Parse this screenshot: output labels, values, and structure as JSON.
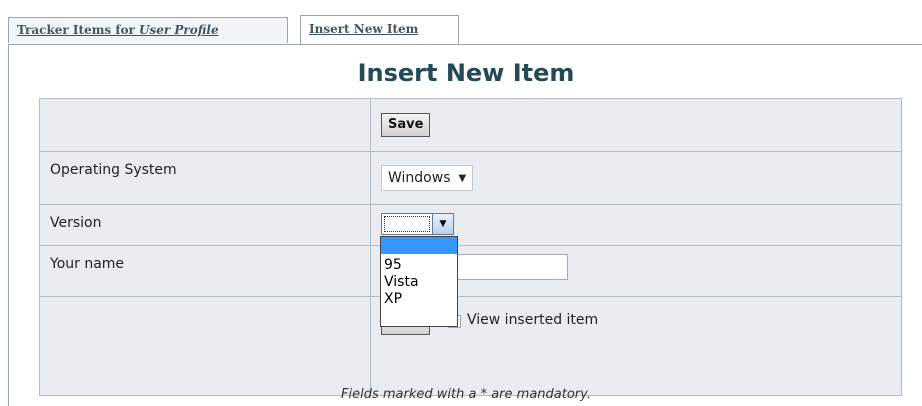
{
  "tabs": [
    {
      "label_prefix": "Tracker Items for ",
      "label_em": "User Profile"
    },
    {
      "label": "Insert New Item"
    }
  ],
  "title": "Insert New Item",
  "rows": {
    "save_top": "Save",
    "os_label": "Operating System",
    "os_value": "Windows",
    "version_label": "Version",
    "version_value": "",
    "name_label": "Your name",
    "name_value": "",
    "save_bottom": "Save",
    "view_inserted": "View inserted item"
  },
  "version_options": [
    "",
    "95",
    "Vista",
    "XP"
  ],
  "footnote": "Fields marked with a * are mandatory."
}
